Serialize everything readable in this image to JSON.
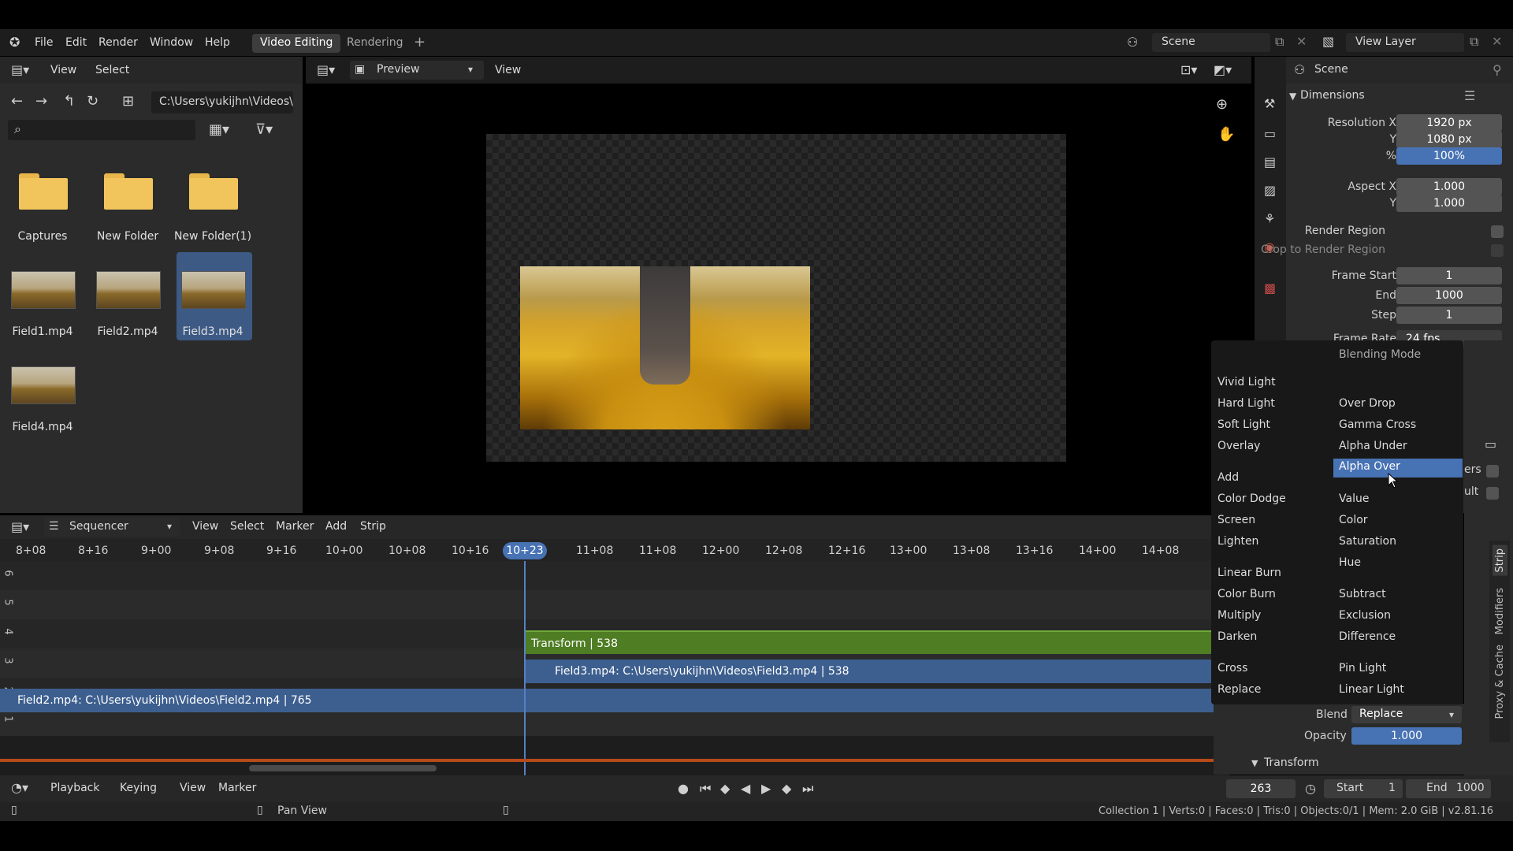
{
  "topbar": {
    "menu": [
      "File",
      "Edit",
      "Render",
      "Window",
      "Help"
    ],
    "workspaces": [
      "Video Editing",
      "Rendering"
    ],
    "add_tab": "+",
    "scene_label": "Scene",
    "view_layer_label": "View Layer"
  },
  "filebrowser": {
    "header_menu": [
      "View",
      "Select"
    ],
    "path": "C:\\Users\\yukijhn\\Videos\\",
    "items": [
      {
        "name": "Captures",
        "kind": "folder"
      },
      {
        "name": "New Folder",
        "kind": "folder"
      },
      {
        "name": "New Folder(1)",
        "kind": "folder"
      },
      {
        "name": "Field1.mp4",
        "kind": "video"
      },
      {
        "name": "Field2.mp4",
        "kind": "video"
      },
      {
        "name": "Field3.mp4",
        "kind": "video",
        "selected": true
      },
      {
        "name": "Field4.mp4",
        "kind": "video"
      }
    ]
  },
  "preview": {
    "mode_label": "Preview",
    "view_label": "View"
  },
  "properties": {
    "scene_name": "Scene",
    "section_dimensions": "Dimensions",
    "rows": [
      {
        "label": "Resolution X",
        "value": "1920 px"
      },
      {
        "label": "Y",
        "value": "1080 px"
      },
      {
        "label": "%",
        "value": "100%",
        "highlight": true
      },
      {
        "label": "Aspect X",
        "value": "1.000"
      },
      {
        "label": "Y",
        "value": "1.000"
      }
    ],
    "render_region": "Render Region",
    "crop_region": "Crop to Render Region",
    "frames": [
      {
        "label": "Frame Start",
        "value": "1"
      },
      {
        "label": "End",
        "value": "1000"
      },
      {
        "label": "Step",
        "value": "1"
      }
    ],
    "frame_rate_label": "Frame Rate",
    "frame_rate_value": "24 fps"
  },
  "sequencer": {
    "editor_label": "Sequencer",
    "menu": [
      "View",
      "Select",
      "Marker",
      "Add",
      "Strip"
    ],
    "ticks": [
      "8+08",
      "8+16",
      "9+00",
      "9+08",
      "9+16",
      "10+00",
      "10+08",
      "10+16",
      "11+08",
      "11+08",
      "12+00",
      "12+08",
      "12+16",
      "13+00",
      "13+08",
      "13+16",
      "14+00",
      "14+08"
    ],
    "current_frame_label": "10+23",
    "channels": [
      "6",
      "5",
      "4",
      "3",
      "2",
      "1"
    ],
    "strips": [
      {
        "label": "Transform | 538",
        "kind": "effect"
      },
      {
        "label": "Field3.mp4: C:\\Users\\yukijhn\\Videos\\Field3.mp4 | 538",
        "kind": "movie"
      },
      {
        "label": "Field2.mp4: C:\\Users\\yukijhn\\Videos\\Field2.mp4 | 765",
        "kind": "movie"
      }
    ]
  },
  "blend_menu": {
    "title": "Blending Mode",
    "left_col": [
      "Vivid Light",
      "Hard Light",
      "Soft Light",
      "Overlay",
      "Add",
      "Color Dodge",
      "Screen",
      "Lighten",
      "Linear Burn",
      "Color Burn",
      "Multiply",
      "Darken",
      "Cross",
      "Replace"
    ],
    "right_col": [
      "Over Drop",
      "Gamma Cross",
      "Alpha Under",
      "Alpha Over",
      "Value",
      "Color",
      "Saturation",
      "Hue",
      "Subtract",
      "Exclusion",
      "Difference",
      "Pin Light",
      "Linear Light"
    ],
    "active": "Alpha Over"
  },
  "strip_panel": {
    "blend_label": "Blend",
    "blend_value": "Replace",
    "opacity_label": "Opacity",
    "opacity_value": "1.000",
    "transform_label": "Transform",
    "side_tabs": [
      "Strip",
      "Modifiers",
      "Proxy & Cache"
    ],
    "partial_texts": [
      "ers",
      "ult"
    ]
  },
  "timeline_bar": {
    "menu": [
      "Playback",
      "Keying",
      "View",
      "Marker"
    ],
    "frame": "263",
    "start_label": "Start",
    "start_value": "1",
    "end_label": "End",
    "end_value": "1000"
  },
  "statusbar": {
    "hint": "Pan View",
    "stats": "Collection 1 | Verts:0 | Faces:0 | Tris:0 | Objects:0/1 | Mem: 2.0 GiB | v2.81.16"
  },
  "colors": {
    "accent": "#4772b3",
    "effect_strip": "#4e7d23",
    "movie_strip": "#3d5f8f",
    "playhead": "#5680c2"
  }
}
